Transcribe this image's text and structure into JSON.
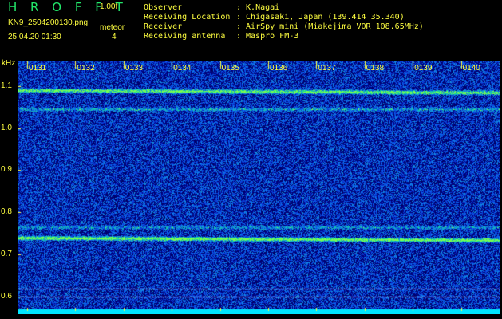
{
  "header": {
    "brand": "H R O F F T",
    "version": "1.00f",
    "filename": "KN9_2504200130.png",
    "meteor_label": "meteor",
    "meteor_count": "4",
    "timestamp": "25.04.20 01:30",
    "info": [
      {
        "label": "Observer",
        "value": ": K.Nagai"
      },
      {
        "label": "Receiving Location",
        "value": ": Chigasaki, Japan (139.414 35.340)"
      },
      {
        "label": "Receiver",
        "value": ": AirSpy mini (Miakejima VOR 108.65MHz)"
      },
      {
        "label": "Receiving antenna",
        "value": ": Maspro FM-3"
      }
    ]
  },
  "chart_data": {
    "type": "heatmap",
    "ylabel": "kHz",
    "y_ticks": [
      "1.1",
      "1.0",
      "0.9",
      "0.8",
      "0.7",
      "0.6"
    ],
    "x_ticks": [
      "0131",
      "0132",
      "0133",
      "0134",
      "0135",
      "0136",
      "0137",
      "0138",
      "0139",
      "0140"
    ],
    "ylim": [
      0.57,
      1.16
    ],
    "bands_khz": [
      {
        "freq": 1.09,
        "strength": 0.8
      },
      {
        "freq": 1.045,
        "strength": 0.35
      },
      {
        "freq": 0.74,
        "strength": 0.9
      },
      {
        "freq": 0.765,
        "strength": 0.3
      }
    ],
    "colors": {
      "background": "#000080",
      "noise": "#2050ff",
      "signal": "#30ff60",
      "axis_text": "#ffff40",
      "brand": "#22e86a"
    }
  }
}
